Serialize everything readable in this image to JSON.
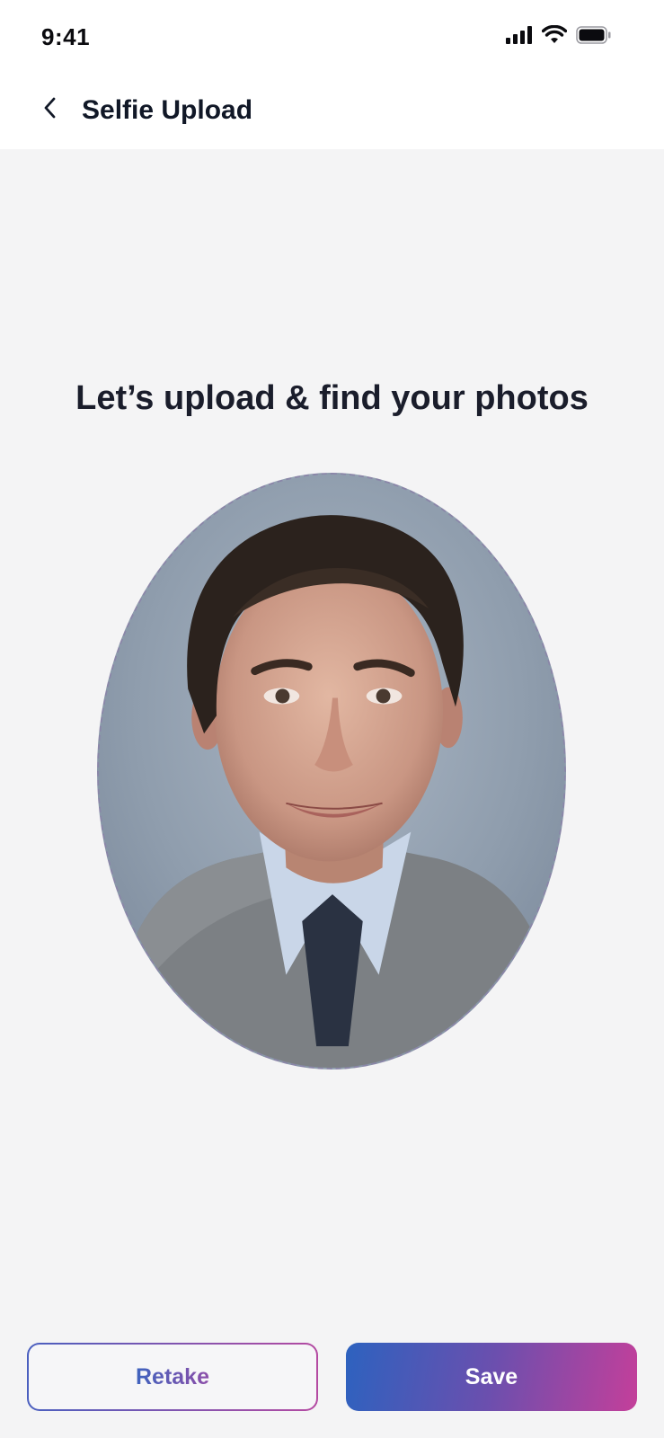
{
  "status_bar": {
    "time": "9:41",
    "icons": [
      "cellular-signal-icon",
      "wifi-icon",
      "battery-icon"
    ]
  },
  "nav": {
    "back_icon": "chevron-left-icon",
    "title": "Selfie Upload"
  },
  "main": {
    "headline": "Let’s upload & find your photos",
    "selfie_image": "portrait-photo"
  },
  "actions": {
    "retake_label": "Retake",
    "save_label": "Save"
  },
  "colors": {
    "gradient_start": "#2d62bf",
    "gradient_mid": "#6b4fae",
    "gradient_end": "#c43f9a",
    "background": "#f4f4f5",
    "text_dark": "#111827"
  }
}
